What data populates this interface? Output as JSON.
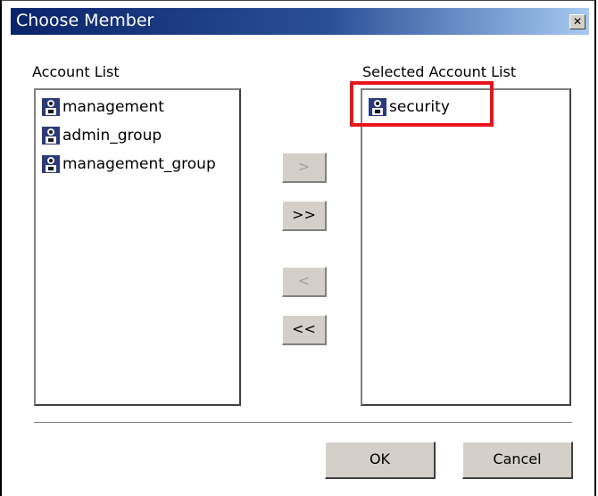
{
  "window": {
    "title": "Choose Member",
    "close_glyph": "✕"
  },
  "account_list": {
    "label": "Account List",
    "items": [
      {
        "name": "management",
        "icon": "user-group-icon"
      },
      {
        "name": "admin_group",
        "icon": "user-group-icon"
      },
      {
        "name": "management_group",
        "icon": "user-group-icon"
      }
    ]
  },
  "selected_list": {
    "label": "Selected Account List",
    "items": [
      {
        "name": "security",
        "icon": "user-group-icon"
      }
    ]
  },
  "transfer_buttons": {
    "add_one": ">",
    "add_all": ">>",
    "remove_one": "<",
    "remove_all": "<<"
  },
  "actions": {
    "ok": "OK",
    "cancel": "Cancel"
  },
  "colors": {
    "highlight": "#e8141c",
    "titlebar_start": "#0a246a",
    "titlebar_end": "#a6caf0"
  }
}
